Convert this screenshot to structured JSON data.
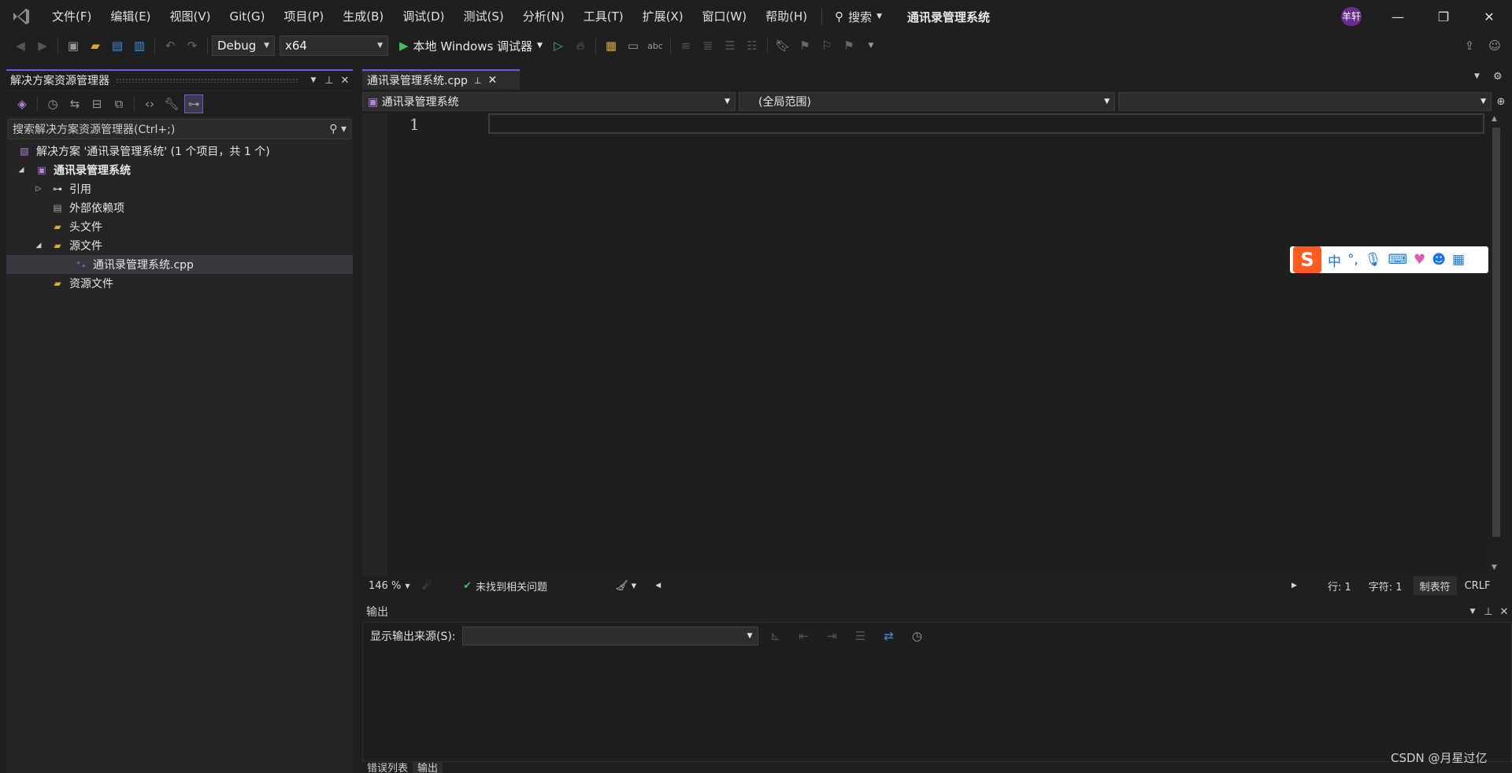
{
  "menu": {
    "items": [
      "文件(F)",
      "编辑(E)",
      "视图(V)",
      "Git(G)",
      "项目(P)",
      "生成(B)",
      "调试(D)",
      "测试(S)",
      "分析(N)",
      "工具(T)",
      "扩展(X)",
      "窗口(W)",
      "帮助(H)"
    ],
    "search_label": "搜索",
    "app_title": "通讯录管理系统",
    "avatar_text": "羊轩"
  },
  "toolbar": {
    "config": "Debug",
    "platform": "x64",
    "run_label": "本地 Windows 调试器"
  },
  "solution_explorer": {
    "title": "解决方案资源管理器",
    "search_placeholder": "搜索解决方案资源管理器(Ctrl+;)",
    "tree": {
      "solution": "解决方案 '通讯录管理系统' (1 个项目，共 1 个)",
      "project": "通讯录管理系统",
      "references": "引用",
      "external_deps": "外部依赖项",
      "header_files": "头文件",
      "source_files": "源文件",
      "source_file_cpp": "通讯录管理系统.cpp",
      "resource_files": "资源文件"
    }
  },
  "editor": {
    "tab_label": "通讯录管理系统.cpp",
    "nav_project": "通讯录管理系统",
    "nav_scope": "(全局范围)",
    "line_number": "1"
  },
  "ime": {
    "mode": "中",
    "punct": "°,"
  },
  "status": {
    "zoom": "146 %",
    "issues": "未找到相关问题",
    "line": "行: 1",
    "char": "字符: 1",
    "tab_mode": "制表符",
    "eol": "CRLF"
  },
  "output": {
    "title": "输出",
    "source_label": "显示输出来源(S):"
  },
  "bottom_tabs": [
    "错误列表",
    "输出"
  ],
  "watermark": "CSDN @月星过亿"
}
